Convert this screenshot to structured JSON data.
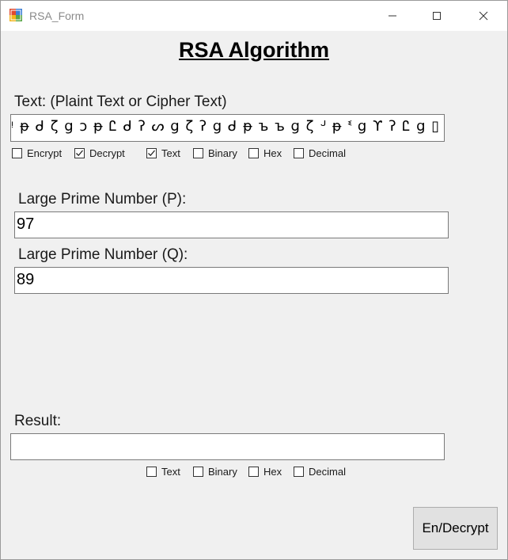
{
  "window": {
    "title": "RSA_Form"
  },
  "heading": "RSA Algorithm",
  "text_section": {
    "label": "Text: (Plaint Text or Cipher Text)",
    "value": "ᵎ ᵽ ᑯ ζ ց ɔ ᵽ Ꮭ ᑯ ʔ ᔕ ց ζ ʔ ց ᑯ ᵽ ъ ъ ց ζ ᒢ ᵽ ᓫ ց ϒ ʔ Ꮭ ց ▯ ᑯ",
    "options": [
      {
        "label": "Encrypt",
        "checked": false
      },
      {
        "label": "Decrypt",
        "checked": true
      },
      {
        "label": "Text",
        "checked": true
      },
      {
        "label": "Binary",
        "checked": false
      },
      {
        "label": "Hex",
        "checked": false
      },
      {
        "label": "Decimal",
        "checked": false
      }
    ]
  },
  "prime_p": {
    "label": "Large Prime Number (P):",
    "value": "97"
  },
  "prime_q": {
    "label": "Large Prime Number (Q):",
    "value": "89"
  },
  "result": {
    "label": "Result:",
    "value": "",
    "options": [
      {
        "label": "Text",
        "checked": false
      },
      {
        "label": "Binary",
        "checked": false
      },
      {
        "label": "Hex",
        "checked": false
      },
      {
        "label": "Decimal",
        "checked": false
      }
    ]
  },
  "button": {
    "label": "En/Decrypt"
  }
}
